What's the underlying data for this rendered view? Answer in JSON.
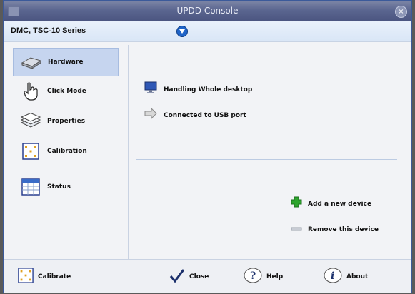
{
  "window": {
    "title": "UPDD Console",
    "close_glyph": "×"
  },
  "device_bar": {
    "device_name": "DMC, TSC-10 Series",
    "dropdown_icon": "chevron-down-circle-icon"
  },
  "sidebar": {
    "items": [
      {
        "label": "Hardware",
        "icon": "hardware-icon",
        "active": true
      },
      {
        "label": "Click Mode",
        "icon": "hand-pointer-icon",
        "active": false
      },
      {
        "label": "Properties",
        "icon": "layers-icon",
        "active": false
      },
      {
        "label": "Calibration",
        "icon": "calibration-icon",
        "active": false
      },
      {
        "label": "Status",
        "icon": "status-table-icon",
        "active": false
      }
    ]
  },
  "main": {
    "handling": "Handling Whole desktop",
    "connection": "Connected to USB port",
    "add_device": "Add a new device",
    "remove_device": "Remove this device"
  },
  "footer": {
    "calibrate": "Calibrate",
    "close": "Close",
    "help": "Help",
    "about": "About"
  },
  "colors": {
    "title_bar": "#5b6690",
    "accent": "#1f64c8",
    "selection": "#c6d5ef",
    "add_green": "#2da52d"
  }
}
